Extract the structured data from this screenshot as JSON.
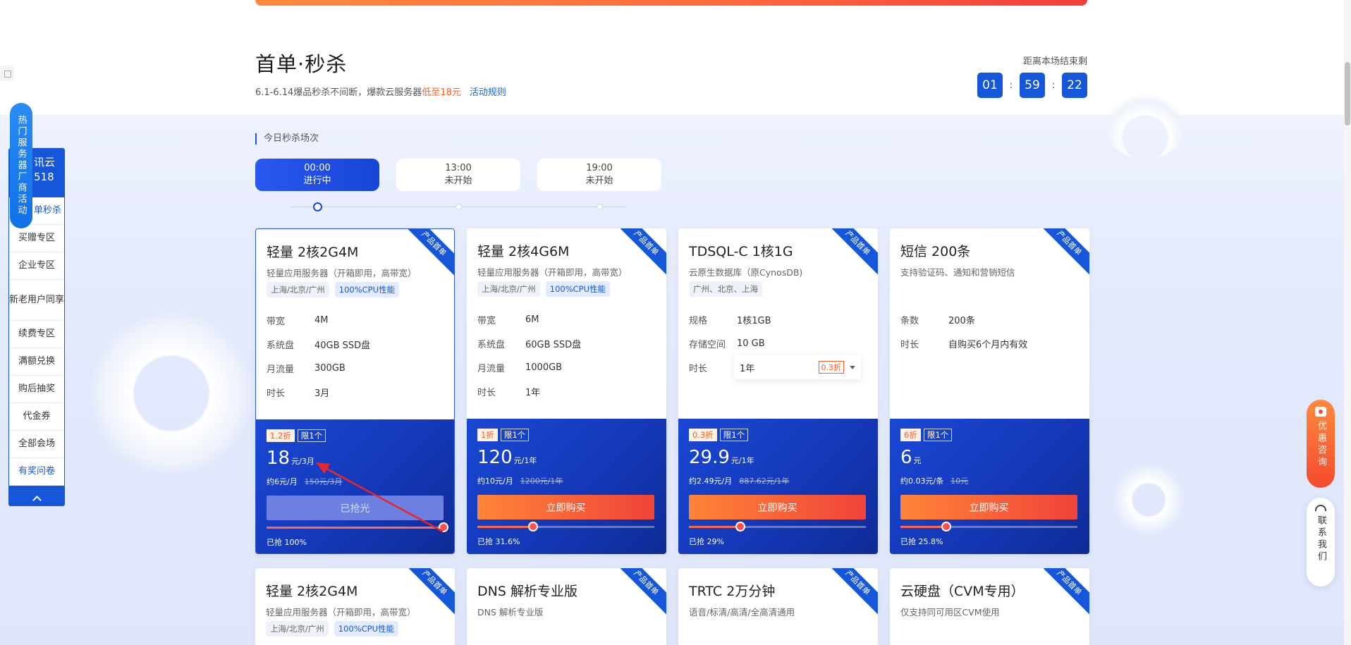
{
  "section": {
    "title": "首单·秒杀",
    "subtitle_prefix": "6.1-6.14爆品秒杀不间断，爆款云服务器",
    "subtitle_highlight": "低至18元",
    "rules_link": "活动规则",
    "highlight_color": "#ff5a1f",
    "accent_color": "#1656d9"
  },
  "countdown": {
    "label": "距离本场结束剩",
    "hours": "01",
    "minutes": "59",
    "seconds": "22",
    "separator": ":"
  },
  "sessions": {
    "label": "今日秒杀场次",
    "items": [
      {
        "time": "00:00",
        "status": "进行中"
      },
      {
        "time": "13:00",
        "status": "未开始"
      },
      {
        "time": "19:00",
        "status": "未开始"
      }
    ]
  },
  "cards": [
    {
      "ribbon": "产品首单",
      "title": "轻量 2核2G4M",
      "desc": "轻量应用服务器（开箱即用，高带宽）",
      "tags": [
        "上海/北京/广州",
        "100%CPU性能"
      ],
      "specs": [
        {
          "k": "带宽",
          "v": "4M"
        },
        {
          "k": "系统盘",
          "v": "40GB SSD盘"
        },
        {
          "k": "月流量",
          "v": "300GB"
        },
        {
          "k": "时长",
          "v": "3月"
        }
      ],
      "discount": "1.2折",
      "limit": "限1个",
      "price": "18",
      "unit": "元/3月",
      "per": "约6元/月",
      "old": "150元/3月",
      "button": "已抢光",
      "sold_label": "已抢 100%",
      "sold": 100
    },
    {
      "ribbon": "产品首单",
      "title": "轻量 2核4G6M",
      "desc": "轻量应用服务器（开箱即用，高带宽）",
      "tags": [
        "上海/北京/广州",
        "100%CPU性能"
      ],
      "specs": [
        {
          "k": "带宽",
          "v": "6M"
        },
        {
          "k": "系统盘",
          "v": "60GB SSD盘"
        },
        {
          "k": "月流量",
          "v": "1000GB"
        },
        {
          "k": "时长",
          "v": "1年"
        }
      ],
      "discount": "1折",
      "limit": "限1个",
      "price": "120",
      "unit": "元/1年",
      "per": "约10元/月",
      "old": "1200元/1年",
      "button": "立即购买",
      "sold_label": "已抢 31.6%",
      "sold": 31.6
    },
    {
      "ribbon": "产品首单",
      "title": "TDSQL-C 1核1G",
      "desc": "云原生数据库（原CynosDB)",
      "tags": [
        "广州、北京、上海"
      ],
      "specs": [
        {
          "k": "规格",
          "v": "1核1GB"
        },
        {
          "k": "存储空间",
          "v": "10 GB"
        }
      ],
      "duration": {
        "k": "时长",
        "v": "1年",
        "badge": "0.3折"
      },
      "discount": "0.3折",
      "limit": "限1个",
      "price": "29.9",
      "unit": "元/1年",
      "per": "约2.49元/月",
      "old": "887.62元/1年",
      "button": "立即购买",
      "sold_label": "已抢 29%",
      "sold": 29
    },
    {
      "ribbon": "产品首单",
      "title": "短信 200条",
      "desc": "支持验证码、通知和营销短信",
      "tags": [],
      "specs": [
        {
          "k": "条数",
          "v": "200条"
        },
        {
          "k": "时长",
          "v": "自购买6个月内有效"
        }
      ],
      "discount": "6折",
      "limit": "限1个",
      "price": "6",
      "unit": "元",
      "per": "约0.03元/条",
      "old": "10元",
      "button": "立即购买",
      "sold_label": "已抢 25.8%",
      "sold": 25.8
    }
  ],
  "cards_row2": [
    {
      "ribbon": "产品首单",
      "title": "轻量 2核2G4M",
      "desc": "轻量应用服务器（开箱即用，高带宽）",
      "tags": [
        "上海/北京/广州",
        "100%CPU性能"
      ]
    },
    {
      "ribbon": "产品首单",
      "title": "DNS 解析专业版",
      "desc": "DNS 解析专业版",
      "tags": []
    },
    {
      "ribbon": "产品首单",
      "title": "TRTC 2万分钟",
      "desc": "语音/标清/高清/全高清通用",
      "tags": []
    },
    {
      "ribbon": "产品首单",
      "title": "云硬盘（CVM专用）",
      "desc": "仅支持同可用区CVM使用",
      "tags": []
    }
  ],
  "sidebar": {
    "brand_line1": "讯云",
    "brand_line2": "518",
    "hot_label": "热门服务器厂商活动",
    "items": [
      {
        "label": "单秒杀",
        "active": true
      },
      {
        "label": "买赠专区"
      },
      {
        "label": "企业专区"
      },
      {
        "label": "新老用户同享",
        "tall": true
      },
      {
        "label": "续费专区"
      },
      {
        "label": "满额兑换"
      },
      {
        "label": "购后抽奖"
      },
      {
        "label": "代金券"
      },
      {
        "label": "全部会场"
      },
      {
        "label": "有奖问卷",
        "survey": true
      }
    ]
  },
  "floats": {
    "promo": "优惠咨询",
    "contact": "联系我们"
  },
  "icons": {
    "chevron_up": "chevron-up-icon",
    "chat": "chat-icon",
    "headset": "headset-icon"
  }
}
